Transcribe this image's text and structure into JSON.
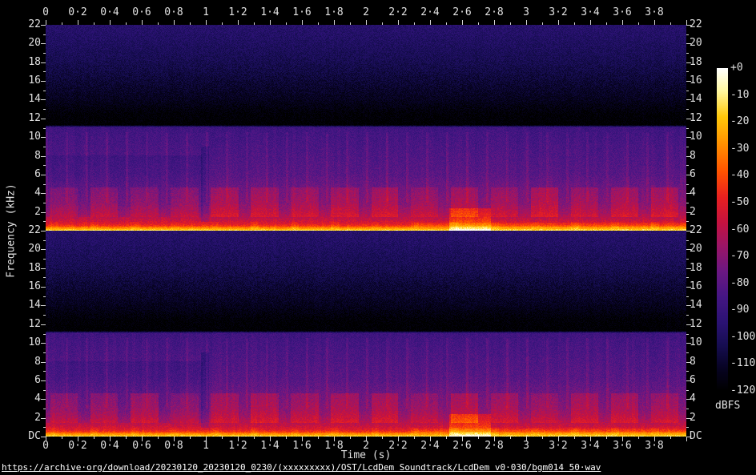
{
  "footer": {
    "url": "https://archive·org/download/20230120_20230120_0230/(xxxxxxxxx)/OST/LcdDem Soundtrack/LcdDem v0·030/bgm014 50·wav"
  },
  "colors": {
    "background": "#000000",
    "axis_text": "#e2e2e2",
    "tick": "#d4d4d4",
    "url_text": "#ffffff"
  },
  "chart_data": {
    "type": "heatmap",
    "subtype": "audio-spectrogram",
    "channels": 2,
    "xlabel": "Time (s)",
    "ylabel": "Frequency (kHz)",
    "x_range_s": [
      0,
      4.0
    ],
    "x_major_step_s": 0.2,
    "x_minor_step_s": 0.1,
    "x_major_tick_labels": [
      "0",
      "0·2",
      "0·4",
      "0·6",
      "0·8",
      "1",
      "1·2",
      "1·4",
      "1·6",
      "1·8",
      "2",
      "2·2",
      "2·4",
      "2·6",
      "2·8",
      "3",
      "3·2",
      "3·4",
      "3·6",
      "3·8"
    ],
    "y_range_khz_per_channel": [
      0,
      22
    ],
    "y_major_step_khz": 2,
    "y_minor_step_khz": 1,
    "y_major_tick_labels": [
      "22",
      "20",
      "18",
      "16",
      "14",
      "12",
      "10",
      "8",
      "6",
      "4",
      "2"
    ],
    "y_dc_label": "DC",
    "colorbar": {
      "unit": "dBFS",
      "range_db": [
        0,
        -120
      ],
      "tick_step_db": 10,
      "tick_labels": [
        "+0",
        "-10",
        "-20",
        "-30",
        "-40",
        "-50",
        "-60",
        "-70",
        "-80",
        "-90",
        "-100",
        "-110",
        "-120"
      ],
      "palette": [
        [
          0.0,
          "#000000"
        ],
        [
          0.07,
          "#070323"
        ],
        [
          0.14,
          "#160d51"
        ],
        [
          0.21,
          "#2a1272"
        ],
        [
          0.29,
          "#441683"
        ],
        [
          0.37,
          "#6b1782"
        ],
        [
          0.45,
          "#9c1566"
        ],
        [
          0.52,
          "#c41240"
        ],
        [
          0.6,
          "#e82020"
        ],
        [
          0.68,
          "#ff5300"
        ],
        [
          0.77,
          "#ff9300"
        ],
        [
          0.85,
          "#ffc80a"
        ],
        [
          0.93,
          "#fff7a0"
        ],
        [
          1.0,
          "#ffffff"
        ]
      ]
    },
    "spectral_model": {
      "description": "Stereo music track, lowpassed near 11 kHz; dither noise rises above 12 kHz toward 22 kHz; bright bass band near DC; rhythmic energy blocks 1.4-4.6 kHz; bass swell around 2.5-2.8 s.",
      "lowpass_khz": 11.05,
      "noise_db_peak_to_peak": 9,
      "freq_profile_db": [
        [
          22,
          -96
        ],
        [
          18,
          -103
        ],
        [
          14,
          -113
        ],
        [
          12.4,
          -119
        ],
        [
          11.3,
          -120
        ],
        [
          11.05,
          -87
        ],
        [
          9,
          -84
        ],
        [
          6,
          -80
        ],
        [
          4.5,
          -75
        ],
        [
          3,
          -71
        ],
        [
          2,
          -65
        ],
        [
          1.2,
          -58
        ],
        [
          0.7,
          -51
        ],
        [
          0.45,
          -43
        ],
        [
          0.3,
          -31
        ],
        [
          0.16,
          -25
        ],
        [
          0.08,
          -19
        ],
        [
          0,
          -14
        ]
      ],
      "beats": {
        "first_s": 0.03,
        "period_s": 0.25,
        "attack_s": 0.17,
        "boost_db": 8,
        "f_lo_khz": 1.4,
        "f_hi_khz": 4.6
      },
      "hihat": {
        "period_s": 0.125,
        "width_s": 0.012,
        "boost_db": 5,
        "f_lo_khz": 3.0,
        "f_hi_khz": 10.5
      },
      "kick": {
        "width_s": 0.05,
        "boost_db": 4,
        "f_lo_khz": 0.1,
        "f_hi_khz": 0.9
      },
      "events": [
        {
          "t0": 0.0,
          "t1": 0.98,
          "f_lo": 1.4,
          "f_hi": 8.0,
          "db": -4,
          "label": "intro (quieter mids)"
        },
        {
          "t0": 0.97,
          "t1": 1.02,
          "f_lo": 0.9,
          "f_hi": 9.0,
          "db": -7,
          "label": "section transition gap"
        },
        {
          "t0": 2.52,
          "t1": 2.78,
          "f_lo": 0.0,
          "f_hi": 2.4,
          "db": 13,
          "label": "bass swell"
        },
        {
          "t0": 2.3,
          "t1": 4.0,
          "f_lo": 0.3,
          "f_hi": 0.85,
          "db": 5,
          "label": "louder low band"
        },
        {
          "t0": 2.55,
          "t1": 4.0,
          "f_lo": 0.08,
          "f_hi": 0.35,
          "db": 3,
          "label": "thicker bottom band"
        }
      ]
    }
  }
}
